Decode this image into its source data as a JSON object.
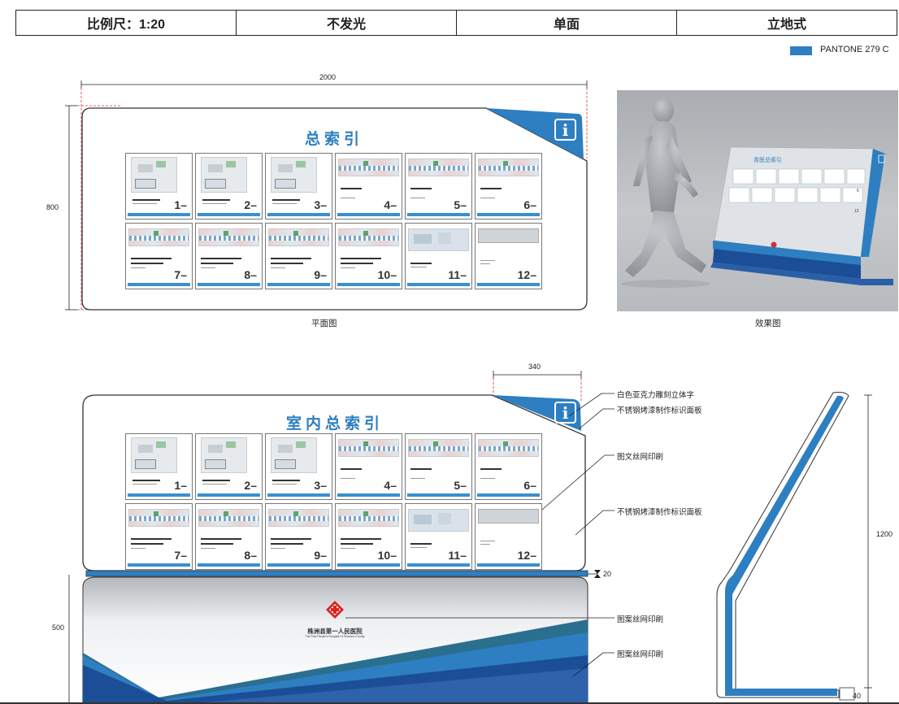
{
  "header": {
    "cells": [
      "比例尺：1:20",
      "不发光",
      "单面",
      "立地式"
    ]
  },
  "legend": {
    "color": "#2e7fc1",
    "label": "PANTONE 279 C"
  },
  "plan": {
    "title": "总索引",
    "caption": "平面图",
    "dim_width": "2000",
    "dim_height": "800"
  },
  "render": {
    "caption": "效果图",
    "sign_title": "青医总索引",
    "sign_labels": [
      "6",
      "12"
    ]
  },
  "elevation": {
    "title": "室内总索引",
    "dim_depth": "340",
    "dim_height_front": "500",
    "dim_gap": "20",
    "dim_height_side": "1200",
    "dim_base": "40"
  },
  "logo": {
    "name": "株洲县第一人民医院",
    "sub": "The First People's Hospital Of Zhuzhou County"
  },
  "annotations": [
    "白色亚克力雕刻立体字",
    "不锈钢烤漆制作标识面板",
    "图文丝网印刷",
    "不锈钢烤漆制作标识面板",
    "图案丝网印刷",
    "图案丝网印刷"
  ],
  "thumbs": [
    "1",
    "2",
    "3",
    "4",
    "5",
    "6",
    "7",
    "8",
    "9",
    "10",
    "11",
    "12"
  ],
  "colors": {
    "blue": "#2e7fc1",
    "deep": "#1b4e96",
    "teal": "#2b6f8f"
  }
}
